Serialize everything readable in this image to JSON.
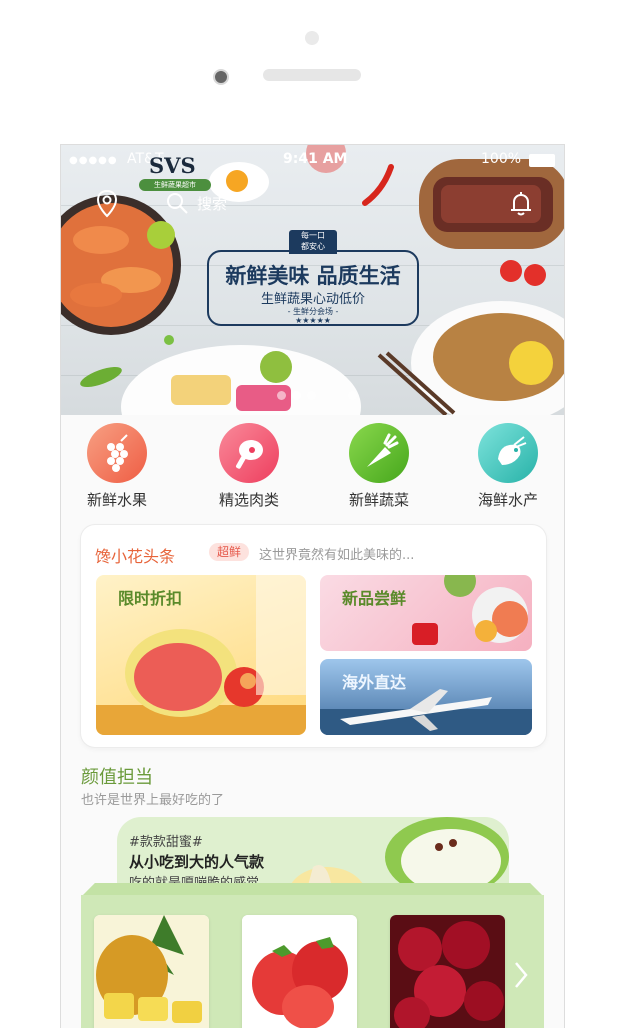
{
  "device": {},
  "status_bar": {
    "signal": "●●●●●",
    "carrier": "AT&T",
    "time": "9:41 AM",
    "battery": "100%"
  },
  "header": {
    "logo_text": "SVS",
    "logo_ribbon": "生鲜蔬果超市",
    "search_placeholder": "搜索"
  },
  "banner": {
    "tag_line1": "每一口",
    "tag_line2": "都安心",
    "headline": "新鲜美味 品质生活",
    "subline": "生鲜蔬果心动低价",
    "venue": "- 生鲜分会场 -",
    "stars": "★★★★★",
    "pages": 4,
    "active_page": 1
  },
  "categories": [
    {
      "label": "新鲜水果",
      "icon": "grapes-icon",
      "color": "#f26b4f"
    },
    {
      "label": "精选肉类",
      "icon": "meat-icon",
      "color": "#f04a6a"
    },
    {
      "label": "新鲜蔬菜",
      "icon": "carrot-icon",
      "color": "#5bb52a"
    },
    {
      "label": "海鲜水产",
      "icon": "shrimp-icon",
      "color": "#3cc0b6"
    }
  ],
  "headline_card": {
    "title": "馋小花头条",
    "badge": "超鲜",
    "text": "这世界竟然有如此美味的...",
    "promos": [
      {
        "label": "限时折扣"
      },
      {
        "label": "新品尝鲜"
      },
      {
        "label": "海外直达"
      }
    ]
  },
  "section": {
    "title": "颜值担当",
    "subtitle": "也许是世界上最好吃的了",
    "feature": {
      "hashtag": "#款款甜蜜#",
      "headline": "从小吃到大的人气款",
      "subline": "吃的就是嘎嘣脆的感觉"
    }
  }
}
